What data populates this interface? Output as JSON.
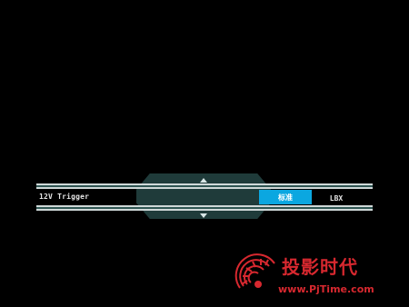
{
  "osd": {
    "row_label": "12V Trigger",
    "options": [
      "标准",
      "LBX"
    ],
    "selected_option": "标准"
  },
  "watermark": {
    "brand": "投影时代",
    "url": "www.PjTime.com"
  },
  "colors": {
    "selected": "#0ba7e0",
    "panel": "#1f3b3a",
    "rail": "#2f5552",
    "watermark": "#d7282f"
  },
  "icons": [
    "up-arrow-icon",
    "down-arrow-icon",
    "watermark-logo-icon"
  ]
}
